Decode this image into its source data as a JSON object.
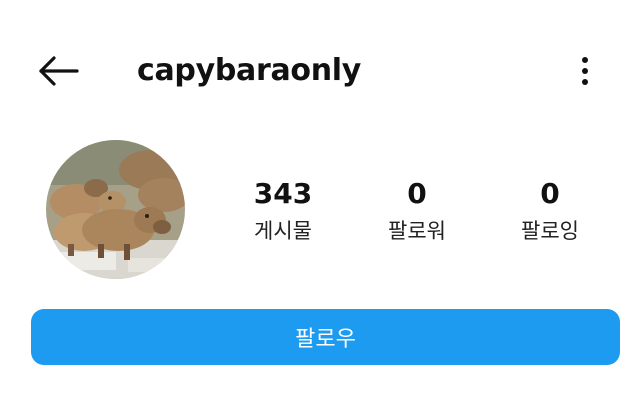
{
  "header": {
    "back_icon": "arrow-left-icon",
    "username": "capybaraonly",
    "more_icon": "more-vertical-icon"
  },
  "profile": {
    "avatar_description": "capybaras photo",
    "stats": [
      {
        "value": "343",
        "label": "게시물"
      },
      {
        "value": "0",
        "label": "팔로워"
      },
      {
        "value": "0",
        "label": "팔로잉"
      }
    ]
  },
  "actions": {
    "follow_label": "팔로우"
  },
  "colors": {
    "accent": "#1c9bf0",
    "text": "#111111",
    "background": "#ffffff"
  }
}
